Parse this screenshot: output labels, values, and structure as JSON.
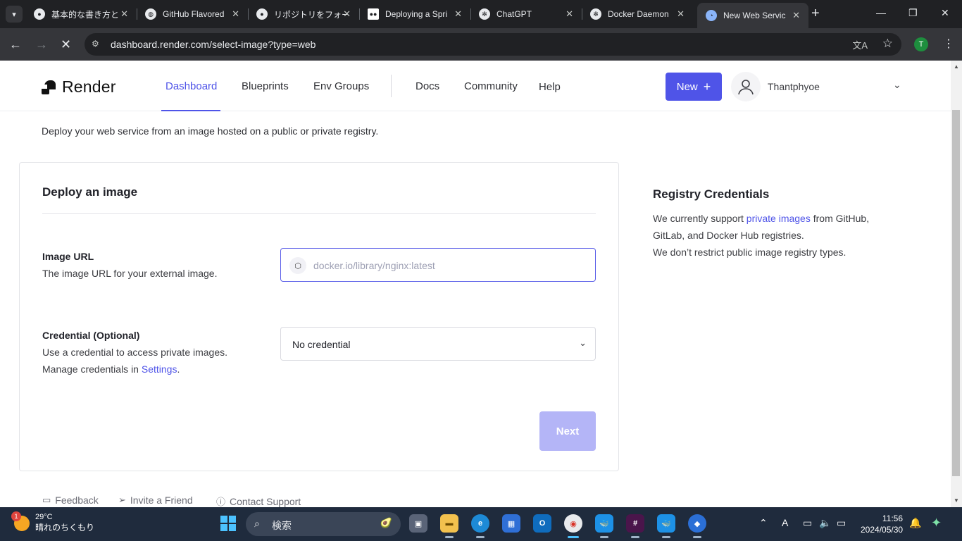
{
  "browser": {
    "tabs": [
      {
        "title": "基本的な書き方と",
        "favicon": "github-icon"
      },
      {
        "title": "GitHub Flavored",
        "favicon": "globe-icon"
      },
      {
        "title": "リポジトリをフォーク",
        "favicon": "github-icon"
      },
      {
        "title": "Deploying a Spri",
        "favicon": "medium-icon"
      },
      {
        "title": "ChatGPT",
        "favicon": "chatgpt-icon"
      },
      {
        "title": "Docker Daemon",
        "favicon": "chatgpt-icon"
      },
      {
        "title": "New Web Servic",
        "favicon": "render-icon"
      }
    ],
    "url": "dashboard.render.com/select-image?type=web",
    "profile_initial": "T"
  },
  "header": {
    "logo_text": "Render",
    "nav": [
      "Dashboard",
      "Blueprints",
      "Env Groups",
      "Docs",
      "Community",
      "Help"
    ],
    "new_button": "New",
    "user_name": "Thantphyoe"
  },
  "main": {
    "subtitle": "Deploy your web service from an image hosted on a public or private registry.",
    "card_title": "Deploy an image",
    "image_url": {
      "label": "Image URL",
      "description": "The image URL for your external image.",
      "placeholder": "docker.io/library/nginx:latest",
      "value": ""
    },
    "credential": {
      "label": "Credential (Optional)",
      "description_line1": "Use a credential to access private images.",
      "description_line2_prefix": "Manage credentials in",
      "settings_link": "Settings",
      "description_line2_suffix": ".",
      "selected": "No credential"
    },
    "next_button": "Next"
  },
  "sidebar": {
    "title": "Registry Credentials",
    "text_prefix": "We currently support",
    "link": "private images",
    "text_suffix": "from GitHub, GitLab, and Docker Hub registries.",
    "text_line3": "We don’t restrict public image registry types."
  },
  "footer": {
    "links": [
      "Feedback",
      "Invite a Friend",
      "Contact Support"
    ]
  },
  "taskbar": {
    "weather_badge": "1",
    "temperature": "29°C",
    "condition": "晴れのちくもり",
    "search_placeholder": "検索",
    "time": "11:56",
    "date": "2024/05/30"
  },
  "colors": {
    "accent": "#4f54e8",
    "next_disabled": "#b4b5f7",
    "taskbar": "#1f2b3d"
  }
}
